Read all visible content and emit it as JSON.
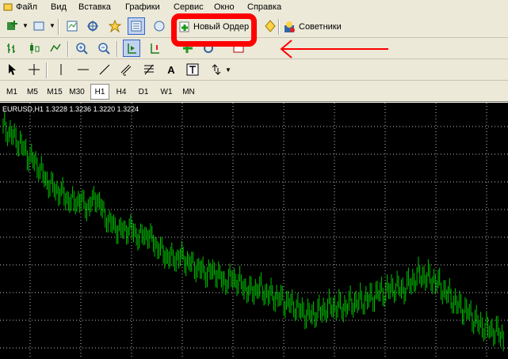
{
  "menu": [
    "Файл",
    "Вид",
    "Вставка",
    "Графики",
    "Сервис",
    "Окно",
    "Справка"
  ],
  "toolbar": {
    "new_order_label": "Новый Ордер",
    "experts_label": "Советники"
  },
  "timeframes": [
    "M1",
    "M5",
    "M15",
    "M30",
    "H1",
    "H4",
    "D1",
    "W1",
    "MN"
  ],
  "active_timeframe": "H1",
  "chart": {
    "label": "EURUSD,H1  1.3228 1.3236 1.3220 1.3224",
    "color": "#00c000",
    "grid_color": "#c0c0c0"
  },
  "annotation_colors": {
    "highlight": "#ff0000",
    "arrow": "#ff0000"
  },
  "chart_data": {
    "type": "line",
    "title": "EURUSD,H1",
    "series": [
      {
        "name": "EURUSD",
        "values": [
          1.3236,
          1.3228,
          1.3218,
          1.3205,
          1.3196,
          1.318,
          1.317,
          1.3165,
          1.3155,
          1.3158,
          1.315,
          1.3162,
          1.314,
          1.313,
          1.3125,
          1.3128,
          1.3118,
          1.3122,
          1.311,
          1.31,
          1.3095,
          1.3098,
          1.309,
          1.3085,
          1.308,
          1.3082,
          1.307,
          1.3075,
          1.3068,
          1.306,
          1.3064,
          1.3058,
          1.3055,
          1.305,
          1.3046,
          1.304,
          1.3035,
          1.3038,
          1.3042,
          1.3045,
          1.3043,
          1.3048,
          1.305,
          1.3052,
          1.3058,
          1.306,
          1.3065,
          1.3062,
          1.307,
          1.3078,
          1.3075,
          1.307,
          1.306,
          1.305,
          1.3042,
          1.3035,
          1.3025,
          1.302,
          1.3018,
          1.301
        ]
      }
    ]
  }
}
